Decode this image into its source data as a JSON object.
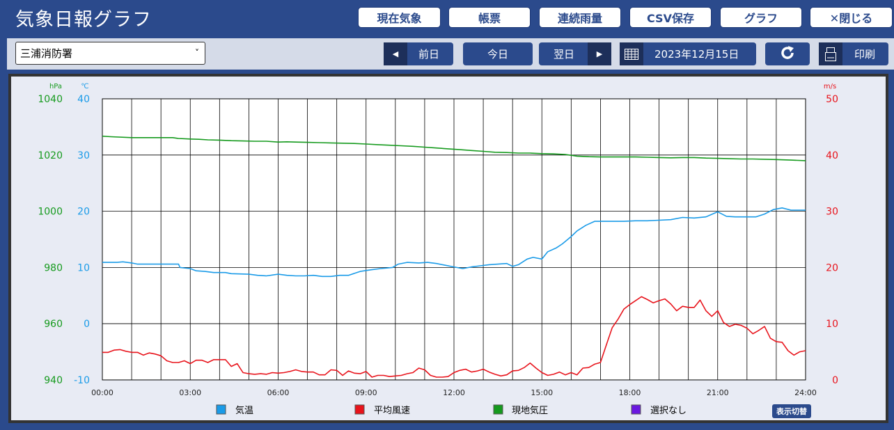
{
  "app": {
    "title": "気象日報グラフ"
  },
  "toolbar": {
    "current": "現在気象",
    "ledger": "帳票",
    "rain": "連続雨量",
    "csv": "CSV保存",
    "graph": "グラフ",
    "close": "✕閉じる"
  },
  "controls": {
    "station": "三浦消防署",
    "prev": "前日",
    "today": "今日",
    "next": "翌日",
    "date": "2023年12月15日",
    "print": "印刷"
  },
  "colors": {
    "temp": "#1a9be8",
    "wind": "#e8131b",
    "pressure": "#159a1d",
    "none": "#6a18e0"
  },
  "legend": {
    "items": [
      "気温",
      "平均風速",
      "現地気圧",
      "選択なし"
    ],
    "toggle": "表示切替"
  },
  "chart_data": {
    "type": "line",
    "x_ticks": [
      "00:00",
      "03:00",
      "06:00",
      "09:00",
      "12:00",
      "15:00",
      "18:00",
      "21:00",
      "24:00"
    ],
    "xlim": [
      0,
      24
    ],
    "axes": {
      "pressure": {
        "unit": "hPa",
        "min": 940,
        "max": 1040,
        "ticks": [
          1040,
          1020,
          1000,
          980,
          960,
          940
        ]
      },
      "temp": {
        "unit": "℃",
        "min": -10,
        "max": 40,
        "ticks": [
          40,
          30,
          20,
          10,
          0,
          -10
        ]
      },
      "wind": {
        "unit": "m/s",
        "min": 0,
        "max": 50,
        "ticks": [
          50,
          40,
          30,
          20,
          10,
          0
        ]
      }
    },
    "series": [
      {
        "name": "気温",
        "axis": "temp",
        "points": [
          [
            0,
            10.9
          ],
          [
            0.5,
            10.9
          ],
          [
            0.7,
            11.0
          ],
          [
            1.0,
            10.8
          ],
          [
            1.2,
            10.6
          ],
          [
            2.0,
            10.6
          ],
          [
            2.5,
            10.6
          ],
          [
            2.6,
            10.6
          ],
          [
            2.65,
            10.0
          ],
          [
            3.0,
            9.8
          ],
          [
            3.2,
            9.4
          ],
          [
            3.5,
            9.3
          ],
          [
            3.8,
            9.1
          ],
          [
            4.2,
            9.1
          ],
          [
            4.4,
            8.9
          ],
          [
            5.0,
            8.8
          ],
          [
            5.3,
            8.6
          ],
          [
            5.6,
            8.5
          ],
          [
            6.0,
            8.8
          ],
          [
            6.3,
            8.6
          ],
          [
            6.6,
            8.5
          ],
          [
            6.9,
            8.5
          ],
          [
            7.2,
            8.6
          ],
          [
            7.5,
            8.4
          ],
          [
            7.8,
            8.4
          ],
          [
            8.1,
            8.6
          ],
          [
            8.4,
            8.6
          ],
          [
            8.8,
            9.3
          ],
          [
            9.2,
            9.6
          ],
          [
            9.5,
            9.8
          ],
          [
            9.9,
            10.0
          ],
          [
            10.1,
            10.6
          ],
          [
            10.4,
            10.9
          ],
          [
            10.8,
            10.8
          ],
          [
            11.1,
            10.9
          ],
          [
            11.4,
            10.7
          ],
          [
            11.7,
            10.4
          ],
          [
            12.0,
            10.1
          ],
          [
            12.3,
            9.8
          ],
          [
            12.6,
            10.1
          ],
          [
            12.9,
            10.3
          ],
          [
            13.2,
            10.5
          ],
          [
            13.5,
            10.6
          ],
          [
            13.8,
            10.7
          ],
          [
            14.0,
            10.2
          ],
          [
            14.2,
            10.5
          ],
          [
            14.5,
            11.5
          ],
          [
            14.7,
            11.8
          ],
          [
            15.0,
            11.5
          ],
          [
            15.2,
            12.8
          ],
          [
            15.5,
            13.5
          ],
          [
            15.7,
            14.2
          ],
          [
            16.0,
            15.5
          ],
          [
            16.2,
            16.5
          ],
          [
            16.5,
            17.5
          ],
          [
            16.8,
            18.2
          ],
          [
            17.3,
            18.2
          ],
          [
            17.8,
            18.2
          ],
          [
            18.2,
            18.3
          ],
          [
            18.6,
            18.3
          ],
          [
            19.0,
            18.4
          ],
          [
            19.4,
            18.5
          ],
          [
            19.8,
            18.9
          ],
          [
            20.2,
            18.8
          ],
          [
            20.6,
            19.0
          ],
          [
            21.0,
            19.9
          ],
          [
            21.3,
            19.1
          ],
          [
            21.6,
            19.0
          ],
          [
            22.0,
            19.0
          ],
          [
            22.3,
            19.0
          ],
          [
            22.6,
            19.5
          ],
          [
            22.9,
            20.3
          ],
          [
            23.2,
            20.6
          ],
          [
            23.5,
            20.2
          ],
          [
            24.0,
            20.2
          ]
        ]
      },
      {
        "name": "平均風速",
        "axis": "wind",
        "points": [
          [
            0,
            4.9
          ],
          [
            0.2,
            4.9
          ],
          [
            0.4,
            5.3
          ],
          [
            0.6,
            5.4
          ],
          [
            0.8,
            5.1
          ],
          [
            1.0,
            4.9
          ],
          [
            1.2,
            4.9
          ],
          [
            1.4,
            4.4
          ],
          [
            1.6,
            4.8
          ],
          [
            1.8,
            4.6
          ],
          [
            2.0,
            4.3
          ],
          [
            2.2,
            3.4
          ],
          [
            2.4,
            3.1
          ],
          [
            2.6,
            3.1
          ],
          [
            2.8,
            3.4
          ],
          [
            3.0,
            2.9
          ],
          [
            3.2,
            3.5
          ],
          [
            3.4,
            3.5
          ],
          [
            3.6,
            3.1
          ],
          [
            3.8,
            3.6
          ],
          [
            4.0,
            3.6
          ],
          [
            4.2,
            3.6
          ],
          [
            4.4,
            2.4
          ],
          [
            4.6,
            2.9
          ],
          [
            4.8,
            1.3
          ],
          [
            5.0,
            1.1
          ],
          [
            5.2,
            1.0
          ],
          [
            5.4,
            1.1
          ],
          [
            5.6,
            1.0
          ],
          [
            5.8,
            1.3
          ],
          [
            6.0,
            1.2
          ],
          [
            6.2,
            1.3
          ],
          [
            6.4,
            1.5
          ],
          [
            6.6,
            1.8
          ],
          [
            6.8,
            1.5
          ],
          [
            7.0,
            1.4
          ],
          [
            7.2,
            1.4
          ],
          [
            7.4,
            0.9
          ],
          [
            7.6,
            0.9
          ],
          [
            7.8,
            1.8
          ],
          [
            8.0,
            1.7
          ],
          [
            8.2,
            0.8
          ],
          [
            8.4,
            1.6
          ],
          [
            8.6,
            1.2
          ],
          [
            8.8,
            1.1
          ],
          [
            9.0,
            1.5
          ],
          [
            9.2,
            0.5
          ],
          [
            9.4,
            0.8
          ],
          [
            9.6,
            0.8
          ],
          [
            9.8,
            0.6
          ],
          [
            10.0,
            0.7
          ],
          [
            10.2,
            0.8
          ],
          [
            10.4,
            1.1
          ],
          [
            10.6,
            1.3
          ],
          [
            10.8,
            2.1
          ],
          [
            11.0,
            1.8
          ],
          [
            11.2,
            0.8
          ],
          [
            11.4,
            0.5
          ],
          [
            11.6,
            0.5
          ],
          [
            11.8,
            0.6
          ],
          [
            12.0,
            1.3
          ],
          [
            12.2,
            1.7
          ],
          [
            12.4,
            1.9
          ],
          [
            12.6,
            1.4
          ],
          [
            12.8,
            1.6
          ],
          [
            13.0,
            1.9
          ],
          [
            13.2,
            1.4
          ],
          [
            13.4,
            1.0
          ],
          [
            13.6,
            0.7
          ],
          [
            13.8,
            0.9
          ],
          [
            14.0,
            1.6
          ],
          [
            14.2,
            1.7
          ],
          [
            14.4,
            2.2
          ],
          [
            14.6,
            3.0
          ],
          [
            14.8,
            2.1
          ],
          [
            15.0,
            1.3
          ],
          [
            15.2,
            0.8
          ],
          [
            15.4,
            1.0
          ],
          [
            15.6,
            1.4
          ],
          [
            15.8,
            0.9
          ],
          [
            16.0,
            1.3
          ],
          [
            16.2,
            0.9
          ],
          [
            16.4,
            2.1
          ],
          [
            16.6,
            2.2
          ],
          [
            16.8,
            2.8
          ],
          [
            17.0,
            3.1
          ],
          [
            17.2,
            6.2
          ],
          [
            17.4,
            9.3
          ],
          [
            17.6,
            10.8
          ],
          [
            17.8,
            12.6
          ],
          [
            18.0,
            13.4
          ],
          [
            18.2,
            14.1
          ],
          [
            18.4,
            14.8
          ],
          [
            18.6,
            14.3
          ],
          [
            18.8,
            13.7
          ],
          [
            19.0,
            14.1
          ],
          [
            19.2,
            14.4
          ],
          [
            19.4,
            13.5
          ],
          [
            19.6,
            12.3
          ],
          [
            19.8,
            13.1
          ],
          [
            20.0,
            12.9
          ],
          [
            20.2,
            12.9
          ],
          [
            20.4,
            14.2
          ],
          [
            20.6,
            12.3
          ],
          [
            20.8,
            11.3
          ],
          [
            21.0,
            12.3
          ],
          [
            21.2,
            10.2
          ],
          [
            21.4,
            9.5
          ],
          [
            21.6,
            9.9
          ],
          [
            21.8,
            9.7
          ],
          [
            22.0,
            9.2
          ],
          [
            22.2,
            8.2
          ],
          [
            22.4,
            8.8
          ],
          [
            22.6,
            9.5
          ],
          [
            22.8,
            7.4
          ],
          [
            23.0,
            6.8
          ],
          [
            23.2,
            6.7
          ],
          [
            23.4,
            5.2
          ],
          [
            23.6,
            4.4
          ],
          [
            23.8,
            5.0
          ],
          [
            24.0,
            5.2
          ]
        ]
      },
      {
        "name": "現地気圧",
        "axis": "pressure",
        "points": [
          [
            0,
            1026.7
          ],
          [
            0.3,
            1026.5
          ],
          [
            1.0,
            1026.2
          ],
          [
            2.0,
            1026.2
          ],
          [
            2.4,
            1026.2
          ],
          [
            2.6,
            1025.9
          ],
          [
            3.0,
            1025.7
          ],
          [
            3.3,
            1025.6
          ],
          [
            3.6,
            1025.4
          ],
          [
            4.0,
            1025.3
          ],
          [
            4.4,
            1025.1
          ],
          [
            4.8,
            1025.0
          ],
          [
            5.2,
            1024.9
          ],
          [
            5.6,
            1024.9
          ],
          [
            6.0,
            1024.6
          ],
          [
            6.3,
            1024.7
          ],
          [
            6.6,
            1024.6
          ],
          [
            7.0,
            1024.5
          ],
          [
            7.4,
            1024.4
          ],
          [
            7.8,
            1024.3
          ],
          [
            8.2,
            1024.2
          ],
          [
            8.6,
            1024.1
          ],
          [
            9.0,
            1023.9
          ],
          [
            9.4,
            1023.7
          ],
          [
            9.8,
            1023.5
          ],
          [
            10.2,
            1023.3
          ],
          [
            10.6,
            1023.1
          ],
          [
            11.0,
            1022.8
          ],
          [
            11.4,
            1022.5
          ],
          [
            11.8,
            1022.2
          ],
          [
            12.2,
            1021.9
          ],
          [
            12.6,
            1021.6
          ],
          [
            13.0,
            1021.3
          ],
          [
            13.4,
            1021.0
          ],
          [
            13.8,
            1020.9
          ],
          [
            14.2,
            1020.7
          ],
          [
            14.6,
            1020.7
          ],
          [
            15.0,
            1020.5
          ],
          [
            15.4,
            1020.4
          ],
          [
            15.8,
            1020.2
          ],
          [
            16.2,
            1019.6
          ],
          [
            16.6,
            1019.4
          ],
          [
            17.0,
            1019.3
          ],
          [
            17.4,
            1019.3
          ],
          [
            17.8,
            1019.3
          ],
          [
            18.2,
            1019.3
          ],
          [
            18.6,
            1019.2
          ],
          [
            19.0,
            1019.1
          ],
          [
            19.4,
            1019.0
          ],
          [
            19.8,
            1019.1
          ],
          [
            20.2,
            1019.1
          ],
          [
            20.6,
            1018.9
          ],
          [
            21.0,
            1018.8
          ],
          [
            21.4,
            1018.7
          ],
          [
            21.8,
            1018.6
          ],
          [
            22.2,
            1018.6
          ],
          [
            22.6,
            1018.5
          ],
          [
            23.0,
            1018.4
          ],
          [
            23.5,
            1018.2
          ],
          [
            24.0,
            1018.0
          ]
        ]
      }
    ]
  }
}
